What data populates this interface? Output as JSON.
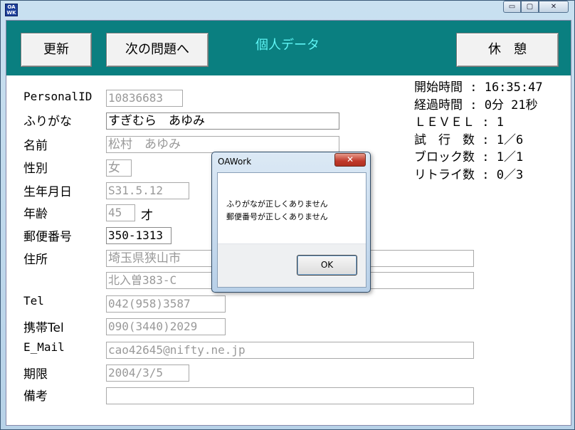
{
  "window": {
    "app_icon_text": "OA\nWORK",
    "minimize": "▭",
    "maximize": "▢",
    "close": "✕"
  },
  "header": {
    "update_label": "更新",
    "next_label": "次の問題へ",
    "title": "個人データ",
    "rest_label": "休　憩"
  },
  "form": {
    "personal_id_label": "PersonalID",
    "personal_id_value": "10836683",
    "furigana_label": "ふりがな",
    "furigana_value": "すぎむら　あゆみ",
    "name_label": "名前",
    "name_value": "松村　あゆみ",
    "gender_label": "性別",
    "gender_value": "女",
    "birthdate_label": "生年月日",
    "birthdate_value": "S31.5.12",
    "age_label": "年齢",
    "age_value": "45",
    "age_unit": "才",
    "postal_label": "郵便番号",
    "postal_value": "350-1313",
    "address_label": "住所",
    "address1_value": "埼玉県狭山市",
    "address2_value": "北入曽383-C",
    "tel_label": "Tel",
    "tel_value": "042(958)3587",
    "mobile_label": "携帯Tel",
    "mobile_value": "090(3440)2029",
    "email_label": "E_Mail",
    "email_value": "cao42645@nifty.ne.jp",
    "deadline_label": "期限",
    "deadline_value": "2004/3/5",
    "remarks_label": "備考",
    "remarks_value": ""
  },
  "status": {
    "start_time": "開始時間 : 16:35:47",
    "elapsed": "経過時間 : 0分 21秒",
    "level": "ＬＥＶＥＬ : 1",
    "trials": "試　行　数 : 1／6",
    "blocks": "ブロック数 : 1／1",
    "retries": "リトライ数 : 0／3"
  },
  "dialog": {
    "title": "OAWork",
    "close": "✕",
    "message1": "ふりがなが正しくありません",
    "message2": "郵便番号が正しくありません",
    "ok_label": "OK"
  }
}
